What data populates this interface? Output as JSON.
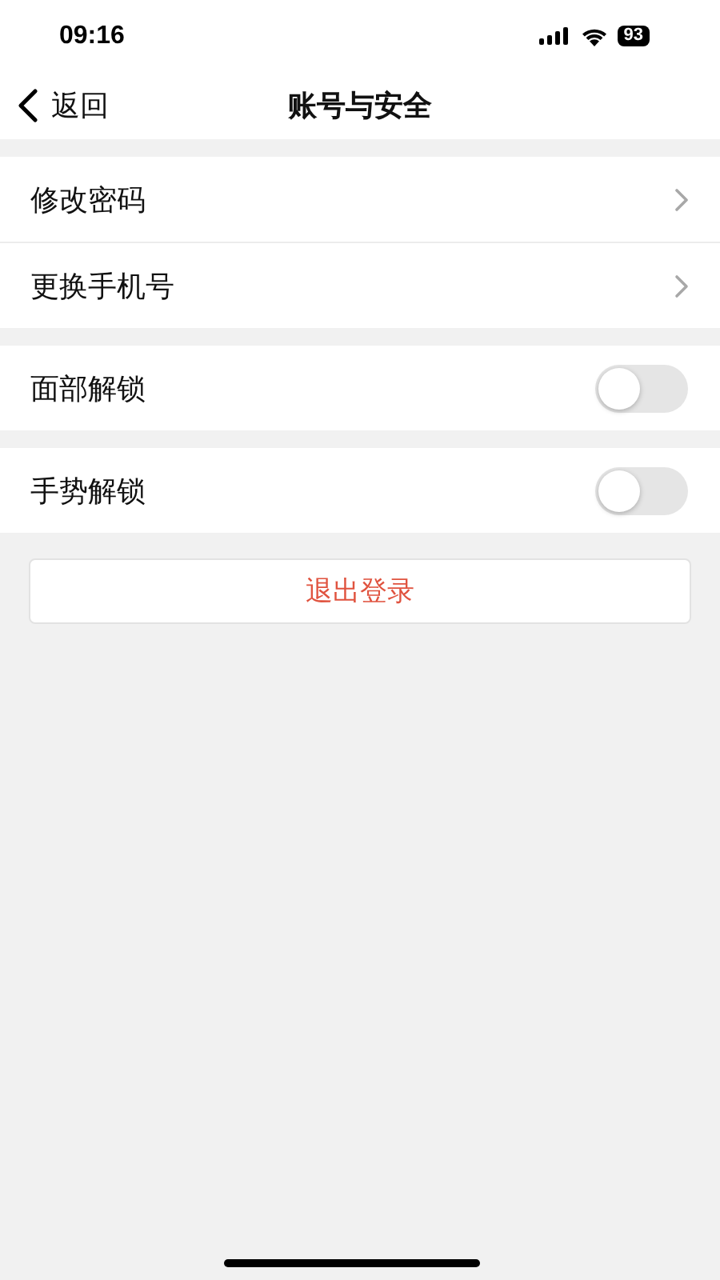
{
  "status_bar": {
    "time": "09:16",
    "battery": "93"
  },
  "nav": {
    "back": "返回",
    "title": "账号与安全"
  },
  "sections": [
    {
      "items": [
        {
          "kind": "link",
          "label": "修改密码"
        },
        {
          "kind": "link",
          "label": "更换手机号"
        }
      ]
    },
    {
      "items": [
        {
          "kind": "toggle",
          "label": "面部解锁",
          "on": false
        }
      ]
    },
    {
      "items": [
        {
          "kind": "toggle",
          "label": "手势解锁",
          "on": false
        }
      ]
    }
  ],
  "logout_button": "退出登录"
}
